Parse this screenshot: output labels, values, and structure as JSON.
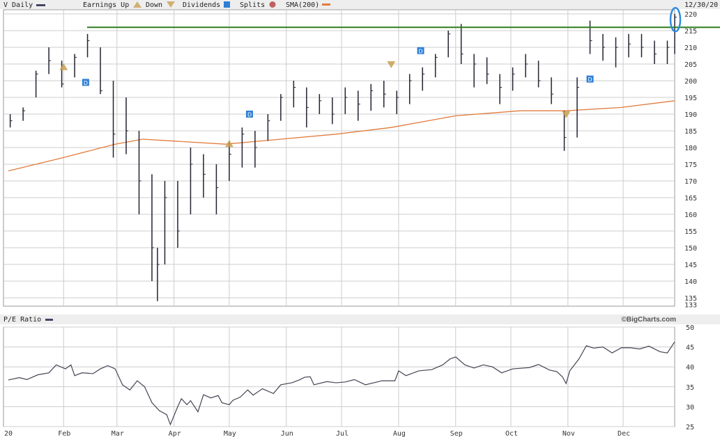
{
  "header": {
    "symbol_label": "V Daily",
    "earnings_label": "Earnings Up",
    "down_label": "Down",
    "dividends_label": "Dividends",
    "splits_label": "Splits",
    "sma_label": "SMA(200)",
    "date_label": "12/30/20"
  },
  "pe_header": {
    "label": "P/E Ratio",
    "brand": "©BigCharts.com"
  },
  "colors": {
    "bars": "#222233",
    "sma": "#e07b3c",
    "resistance": "#2e7d1e",
    "dividend": "#2f7fd6",
    "earnings": "#c8a050",
    "highlight": "#2f8be0",
    "pe": "#444455",
    "grid": "#cccccc",
    "split": "#c06060"
  },
  "chart_data": [
    {
      "type": "ohlc",
      "title": "V Daily",
      "ylim": [
        133,
        221
      ],
      "yticks": [
        220,
        215,
        210,
        205,
        200,
        195,
        190,
        185,
        180,
        175,
        170,
        165,
        160,
        155,
        150,
        145,
        140,
        135,
        133
      ],
      "x_unit": "day of year 2020",
      "xticks": [
        {
          "label": "20",
          "x": 2
        },
        {
          "label": "Feb",
          "x": 32
        },
        {
          "label": "Mar",
          "x": 61
        },
        {
          "label": "Apr",
          "x": 92
        },
        {
          "label": "May",
          "x": 122
        },
        {
          "label": "Jun",
          "x": 153
        },
        {
          "label": "Jul",
          "x": 183
        },
        {
          "label": "Aug",
          "x": 214
        },
        {
          "label": "Sep",
          "x": 245
        },
        {
          "label": "Oct",
          "x": 275
        },
        {
          "label": "Nov",
          "x": 306
        },
        {
          "label": "Dec",
          "x": 336
        }
      ],
      "bars": [
        [
          3,
          190,
          186,
          188
        ],
        [
          10,
          192,
          188,
          191
        ],
        [
          17,
          203,
          195,
          202
        ],
        [
          24,
          210,
          202,
          206
        ],
        [
          31,
          206,
          198,
          199
        ],
        [
          38,
          208,
          201,
          207
        ],
        [
          45,
          214,
          207,
          212
        ],
        [
          52,
          210,
          196,
          197
        ],
        [
          59,
          200,
          177,
          184
        ],
        [
          66,
          195,
          178,
          185
        ],
        [
          73,
          185,
          160,
          170
        ],
        [
          80,
          172,
          140,
          150
        ],
        [
          83,
          150,
          134,
          145
        ],
        [
          87,
          170,
          145,
          165
        ],
        [
          94,
          170,
          150,
          155
        ],
        [
          101,
          180,
          160,
          175
        ],
        [
          108,
          178,
          165,
          172
        ],
        [
          115,
          175,
          160,
          168
        ],
        [
          122,
          182,
          170,
          178
        ],
        [
          129,
          186,
          174,
          184
        ],
        [
          136,
          185,
          174,
          180
        ],
        [
          143,
          190,
          182,
          188
        ],
        [
          150,
          196,
          188,
          195
        ],
        [
          157,
          200,
          192,
          198
        ],
        [
          164,
          198,
          186,
          192
        ],
        [
          171,
          196,
          190,
          194
        ],
        [
          178,
          195,
          187,
          190
        ],
        [
          185,
          198,
          190,
          195
        ],
        [
          192,
          197,
          188,
          193
        ],
        [
          199,
          199,
          191,
          197
        ],
        [
          206,
          200,
          192,
          196
        ],
        [
          213,
          197,
          190,
          195
        ],
        [
          220,
          202,
          193,
          200
        ],
        [
          227,
          204,
          197,
          202
        ],
        [
          234,
          208,
          201,
          207
        ],
        [
          241,
          215,
          207,
          214
        ],
        [
          248,
          217,
          205,
          208
        ],
        [
          255,
          208,
          198,
          205
        ],
        [
          262,
          207,
          199,
          202
        ],
        [
          269,
          202,
          193,
          198
        ],
        [
          276,
          204,
          197,
          202
        ],
        [
          283,
          208,
          201,
          205
        ],
        [
          290,
          206,
          198,
          200
        ],
        [
          297,
          201,
          193,
          196
        ],
        [
          304,
          191,
          179,
          183
        ],
        [
          311,
          201,
          183,
          198
        ],
        [
          318,
          218,
          208,
          212
        ],
        [
          325,
          214,
          206,
          210
        ],
        [
          332,
          213,
          204,
          210
        ],
        [
          339,
          214,
          207,
          211
        ],
        [
          346,
          214,
          207,
          210
        ],
        [
          353,
          212,
          205,
          208
        ],
        [
          360,
          212,
          205,
          210
        ],
        [
          364,
          220,
          208,
          219
        ]
      ],
      "sma200": [
        [
          2,
          173
        ],
        [
          32,
          177
        ],
        [
          60,
          181
        ],
        [
          75,
          182.5
        ],
        [
          120,
          181
        ],
        [
          150,
          182.5
        ],
        [
          180,
          184
        ],
        [
          210,
          186
        ],
        [
          245,
          189.5
        ],
        [
          280,
          191
        ],
        [
          305,
          191
        ],
        [
          335,
          192
        ],
        [
          364,
          194
        ]
      ],
      "resistance_level": 216,
      "earnings_up": [
        [
          32,
          204
        ],
        [
          122,
          181
        ]
      ],
      "earnings_down": [
        [
          210,
          205
        ],
        [
          305,
          190
        ]
      ],
      "dividends": [
        [
          44,
          199.5
        ],
        [
          133,
          190
        ],
        [
          226,
          209
        ],
        [
          318,
          200.5
        ]
      ],
      "highlight_point": [
        364,
        216
      ]
    },
    {
      "type": "line",
      "title": "P/E Ratio",
      "ylim": [
        25,
        50
      ],
      "yticks": [
        50,
        45,
        40,
        35,
        30,
        25
      ],
      "values": [
        [
          2,
          36.7
        ],
        [
          8,
          37.3
        ],
        [
          12,
          36.8
        ],
        [
          18,
          38
        ],
        [
          24,
          38.5
        ],
        [
          28,
          40.5
        ],
        [
          33,
          39.5
        ],
        [
          36,
          40.5
        ],
        [
          38,
          37.8
        ],
        [
          42,
          38.5
        ],
        [
          48,
          38.3
        ],
        [
          52,
          39.5
        ],
        [
          56,
          40.3
        ],
        [
          60,
          39.5
        ],
        [
          64,
          35.5
        ],
        [
          68,
          34.2
        ],
        [
          72,
          36.5
        ],
        [
          76,
          35
        ],
        [
          80,
          31
        ],
        [
          84,
          29
        ],
        [
          88,
          28
        ],
        [
          90,
          25.5
        ],
        [
          94,
          30
        ],
        [
          96,
          32
        ],
        [
          99,
          30.5
        ],
        [
          101,
          31.5
        ],
        [
          105,
          28.7
        ],
        [
          108,
          33
        ],
        [
          112,
          32.2
        ],
        [
          116,
          32.8
        ],
        [
          118,
          31
        ],
        [
          122,
          30.5
        ],
        [
          124,
          31.6
        ],
        [
          128,
          32.4
        ],
        [
          132,
          34.2
        ],
        [
          135,
          32.9
        ],
        [
          140,
          34.5
        ],
        [
          146,
          33.3
        ],
        [
          150,
          35.5
        ],
        [
          156,
          36
        ],
        [
          160,
          36.7
        ],
        [
          163,
          37.4
        ],
        [
          166,
          37.5
        ],
        [
          168,
          35.5
        ],
        [
          175,
          36.3
        ],
        [
          180,
          36
        ],
        [
          185,
          36.2
        ],
        [
          190,
          36.8
        ],
        [
          196,
          35.5
        ],
        [
          205,
          36.5
        ],
        [
          212,
          36.5
        ],
        [
          214,
          39
        ],
        [
          218,
          37.8
        ],
        [
          225,
          39
        ],
        [
          232,
          39.3
        ],
        [
          238,
          40.5
        ],
        [
          242,
          42
        ],
        [
          245,
          42.5
        ],
        [
          250,
          40.5
        ],
        [
          255,
          39.7
        ],
        [
          260,
          40.5
        ],
        [
          265,
          40
        ],
        [
          270,
          38.5
        ],
        [
          276,
          39.5
        ],
        [
          285,
          39.8
        ],
        [
          290,
          40.6
        ],
        [
          296,
          39.2
        ],
        [
          300,
          38.8
        ],
        [
          303,
          37.5
        ],
        [
          305,
          35.8
        ],
        [
          307,
          39
        ],
        [
          312,
          42
        ],
        [
          316,
          45.3
        ],
        [
          320,
          44.7
        ],
        [
          325,
          45
        ],
        [
          330,
          43.5
        ],
        [
          335,
          44.8
        ],
        [
          340,
          44.8
        ],
        [
          345,
          44.5
        ],
        [
          350,
          45.2
        ],
        [
          356,
          43.8
        ],
        [
          360,
          43.5
        ],
        [
          364,
          46.3
        ]
      ]
    }
  ]
}
